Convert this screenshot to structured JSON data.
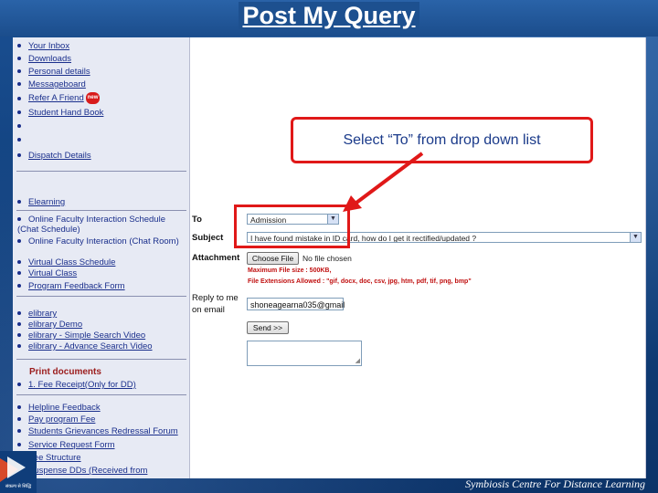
{
  "slide": {
    "title": "Post My Query",
    "callout": "Select “To” from drop down list",
    "footer": "Symbiosis Centre For Distance Learning",
    "logo_text": "संकल्प से सिद्धि"
  },
  "nav": {
    "top_items": [
      {
        "label": "Your Inbox"
      },
      {
        "label": "Downloads"
      },
      {
        "label": "Personal details"
      },
      {
        "label": "Messageboard"
      },
      {
        "label": "Refer A Friend",
        "badge": "new"
      },
      {
        "label": "Student Hand Book"
      },
      {
        "label": ""
      },
      {
        "label": ""
      },
      {
        "label": "Dispatch Details"
      }
    ],
    "elearning": "Elearning",
    "elearning_items": [
      {
        "label": "Online Faculty Interaction Schedule (Chat Schedule)"
      },
      {
        "label": "Online Faculty Interaction (Chat Room)"
      },
      {
        "label": "Virtual Class Schedule"
      },
      {
        "label": "Virtual Class"
      },
      {
        "label": "Program Feedback Form"
      }
    ],
    "library_items": [
      {
        "label": "elibrary"
      },
      {
        "label": "elibrary Demo"
      },
      {
        "label": "elibrary - Simple Search Video"
      },
      {
        "label": "elibrary - Advance Search Video"
      }
    ],
    "print_title": "Print documents",
    "print_items": [
      {
        "label": "1. Fee Receipt(Only for DD)"
      }
    ],
    "bottom_items": [
      {
        "label": "Helpline Feedback"
      },
      {
        "label": "Pay program Fee"
      },
      {
        "label": "Students Grievances Redressal Forum"
      },
      {
        "label": "Service Request Form"
      },
      {
        "label": "Fee Structure"
      },
      {
        "label": "Suspense DDs (Received from"
      }
    ]
  },
  "form": {
    "to_label": "To",
    "to_value": "Admission",
    "subject_label": "Subject",
    "subject_value": "I have found mistake in ID card, how do I get it rectified/updated ?",
    "attachment_label": "Attachment",
    "choose_file": "Choose File",
    "no_file": "No file chosen",
    "max_size": "Maximum File size : 500KB,",
    "extensions": "File Extensions Allowed : \"gif, docx, doc, csv, jpg, htm, pdf, tif, png, bmp\"",
    "reply_label_1": "Reply to me",
    "reply_label_2": "on email",
    "email_value": "shoneagearna035@gmail",
    "send_label": "Send >>"
  },
  "colors": {
    "slide_blue": "#1a4f92",
    "highlight_red": "#e01818",
    "nav_link": "#1a2f8c",
    "section_red": "#9b1c1c"
  }
}
